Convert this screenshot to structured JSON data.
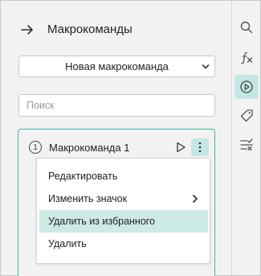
{
  "panel": {
    "title": "Макрокоманды",
    "macro_select": {
      "value": "Новая макрокоманда"
    },
    "search": {
      "placeholder": "Поиск"
    }
  },
  "macro_card": {
    "number": "1",
    "title": "Макрокоманда 1"
  },
  "context_menu": {
    "items": [
      {
        "label": "Редактировать"
      },
      {
        "label": "Изменить значок"
      },
      {
        "label": "Удалить из избранного"
      },
      {
        "label": "Удалить"
      }
    ]
  },
  "sidebar": {
    "icons": [
      "search-icon",
      "function-icon",
      "play-icon",
      "tag-icon",
      "checklist-icon"
    ],
    "active": "play-icon"
  },
  "colors": {
    "accent": "#3bb5a6",
    "highlight": "#cdeae7",
    "panel_bg": "#f2f2f2"
  }
}
